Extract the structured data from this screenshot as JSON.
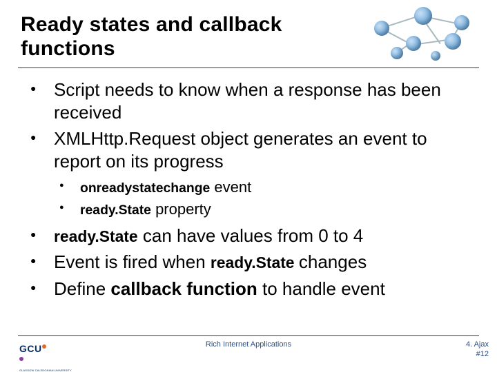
{
  "title": "Ready states and callback functions",
  "bullets": {
    "b1": "Script needs to know when a response has been received",
    "b2_pre": "XMLHttp.",
    "b2_post": "Request object generates an event to report on its progress",
    "sub1_code": "onreadystatechange",
    "sub1_tail": " event",
    "sub2_code": "ready.",
    "sub2_code2": "State",
    "sub2_tail": " property",
    "b3_code": "ready.",
    "b3_code2": "State",
    "b3_tail": " can have values from 0 to 4",
    "b4_pre": "Event is fired when ",
    "b4_code": "ready.",
    "b4_code2": "State ",
    "b4_tail": "changes",
    "b5_pre": "Define ",
    "b5_bold": "callback function",
    "b5_tail": " to handle event"
  },
  "footer": {
    "center": "Rich Internet Applications",
    "right_top": "4. Ajax",
    "right_bot": "#12"
  },
  "logo": {
    "text": "GCU",
    "sub": "GLASGOW CALEDONIAN UNIVERSITY"
  }
}
